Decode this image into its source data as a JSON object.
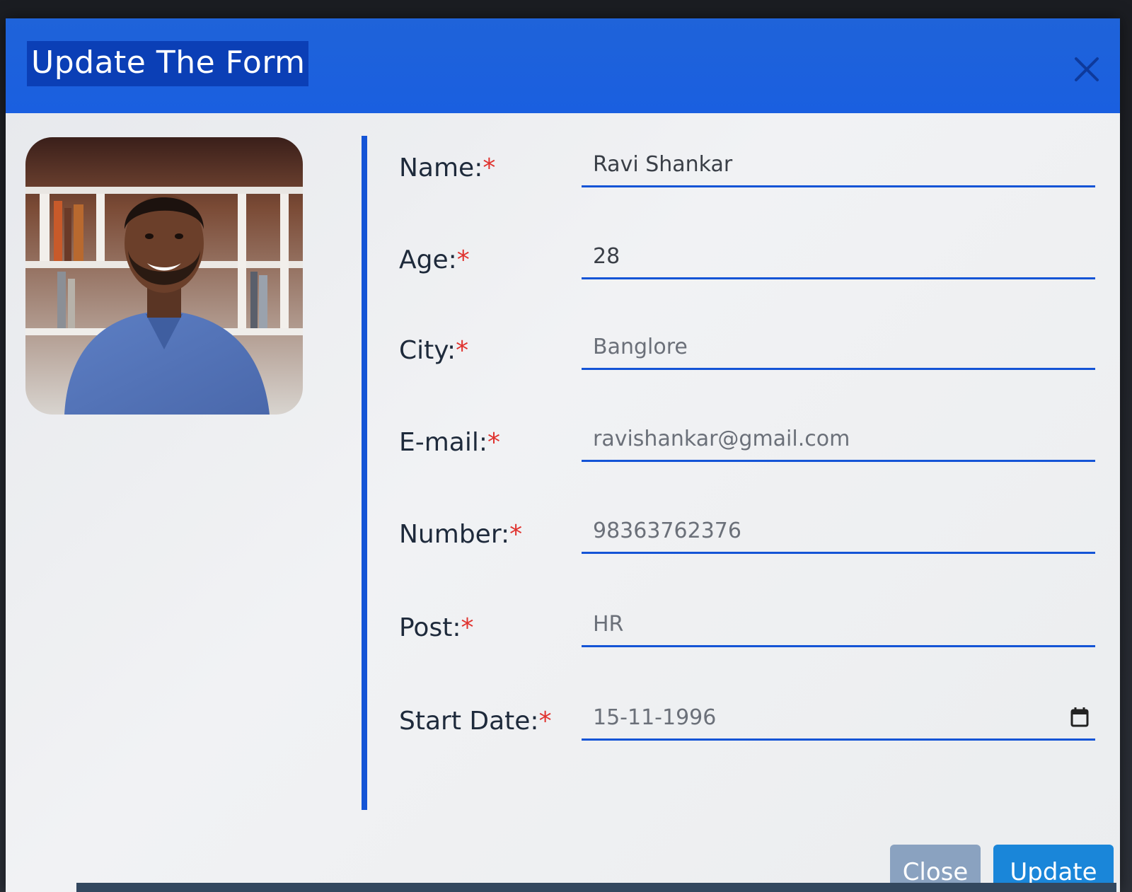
{
  "modal": {
    "title": "Update The Form",
    "close_icon": "close-icon",
    "photo": "profile-photo"
  },
  "form": {
    "required_marker": "*",
    "fields": [
      {
        "label": "Name:",
        "value": "Ravi Shankar"
      },
      {
        "label": "Age:",
        "value": "28"
      },
      {
        "label": "City:",
        "value": "Banglore"
      },
      {
        "label": "E-mail:",
        "value": "ravishankar@gmail.com"
      },
      {
        "label": "Number:",
        "value": "98363762376"
      },
      {
        "label": "Post:",
        "value": "HR"
      },
      {
        "label": "Start Date:",
        "value": "15-11-1996",
        "icon": "calendar-icon"
      }
    ]
  },
  "footer": {
    "close_label": "Close",
    "update_label": "Update"
  },
  "colors": {
    "header": "#1a5fe0",
    "accent": "#1454d6",
    "required": "#e0332f",
    "update_button": "#1a86d9",
    "close_button": "#8aa2c0"
  }
}
